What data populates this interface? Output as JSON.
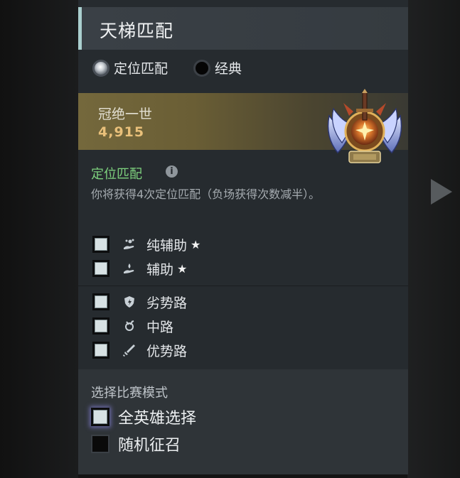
{
  "panel": {
    "title": "天梯匹配",
    "modes": [
      {
        "label": "定位匹配",
        "selected": true
      },
      {
        "label": "经典",
        "selected": false
      }
    ],
    "rank": {
      "name": "冠绝一世",
      "mmr": "4,915",
      "medal_icon": "immortal-medal-icon"
    },
    "calibration": {
      "title": "定位匹配",
      "description": "你将获得4次定位匹配（负场获得次数减半）。"
    },
    "roles_support": [
      {
        "label": "纯辅助",
        "icon": "hard-support-icon",
        "starred": true,
        "checked": true
      },
      {
        "label": "辅助",
        "icon": "soft-support-icon",
        "starred": true,
        "checked": true
      }
    ],
    "roles_core": [
      {
        "label": "劣势路",
        "icon": "offlane-icon",
        "starred": false,
        "checked": true
      },
      {
        "label": "中路",
        "icon": "midlane-icon",
        "starred": false,
        "checked": true
      },
      {
        "label": "优势路",
        "icon": "safelane-icon",
        "starred": false,
        "checked": true
      }
    ],
    "star_glyph": "★",
    "game_mode": {
      "title": "选择比赛模式",
      "options": [
        {
          "label": "全英雄选择",
          "checked": true
        },
        {
          "label": "随机征召",
          "checked": false
        }
      ]
    }
  },
  "colors": {
    "header_accent": "#aacfcf",
    "calibration_title": "#7ed27e",
    "mmr": "#e9c07a"
  }
}
